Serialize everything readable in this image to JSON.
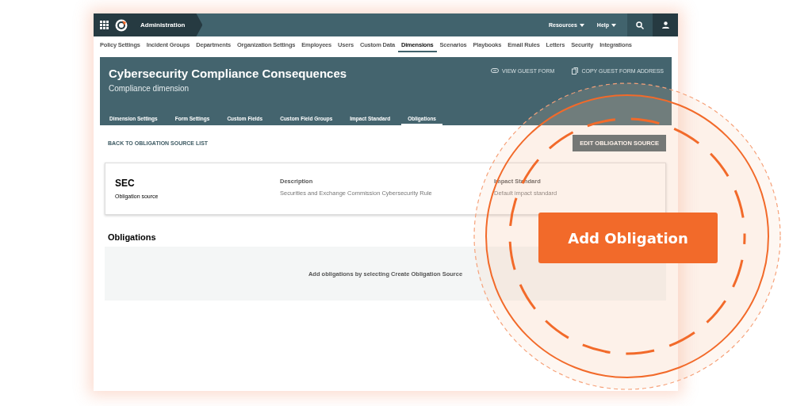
{
  "topbar": {
    "title": "Administration",
    "menus": [
      {
        "label": "Resources"
      },
      {
        "label": "Help"
      }
    ]
  },
  "nav": [
    {
      "label": "Policy Settings",
      "selected": false
    },
    {
      "label": "Incident Groups",
      "selected": false
    },
    {
      "label": "Departments",
      "selected": false
    },
    {
      "label": "Organization Settings",
      "selected": false
    },
    {
      "label": "Employees",
      "selected": false
    },
    {
      "label": "Users",
      "selected": false
    },
    {
      "label": "Custom Data",
      "selected": false
    },
    {
      "label": "Dimensions",
      "selected": true
    },
    {
      "label": "Scenarios",
      "selected": false
    },
    {
      "label": "Playbooks",
      "selected": false
    },
    {
      "label": "Email Rules",
      "selected": false
    },
    {
      "label": "Letters",
      "selected": false
    },
    {
      "label": "Security",
      "selected": false
    },
    {
      "label": "Integrations",
      "selected": false
    }
  ],
  "header": {
    "title": "Cybersecurity Compliance Consequences",
    "subtitle": "Compliance dimension",
    "actions": [
      {
        "kind": "link",
        "label": "VIEW GUEST FORM"
      },
      {
        "kind": "copy",
        "label": "COPY GUEST FORM ADDRESS"
      }
    ],
    "tabs": [
      {
        "label": "Dimension Settings",
        "selected": false
      },
      {
        "label": "Form Settings",
        "selected": false
      },
      {
        "label": "Custom Fields",
        "selected": false
      },
      {
        "label": "Custom Field Groups",
        "selected": false
      },
      {
        "label": "Impact Standard",
        "selected": false
      },
      {
        "label": "Obligations",
        "selected": true
      }
    ]
  },
  "back_link": "BACK TO OBLIGATION SOURCE LIST",
  "edit_button": "EDIT OBLIGATION SOURCE",
  "source": {
    "name": "SEC",
    "type": "Obligation source",
    "fields": [
      {
        "label": "Description",
        "value": "Securities and Exchange Commission Cybersecurity Rule"
      },
      {
        "label": "Impact Standard",
        "value": "Default impact standard"
      }
    ]
  },
  "obligations": {
    "heading": "Obligations",
    "empty": "Add obligations by selecting Create Obligation Source"
  },
  "callout": {
    "button": "Add Obligation"
  }
}
